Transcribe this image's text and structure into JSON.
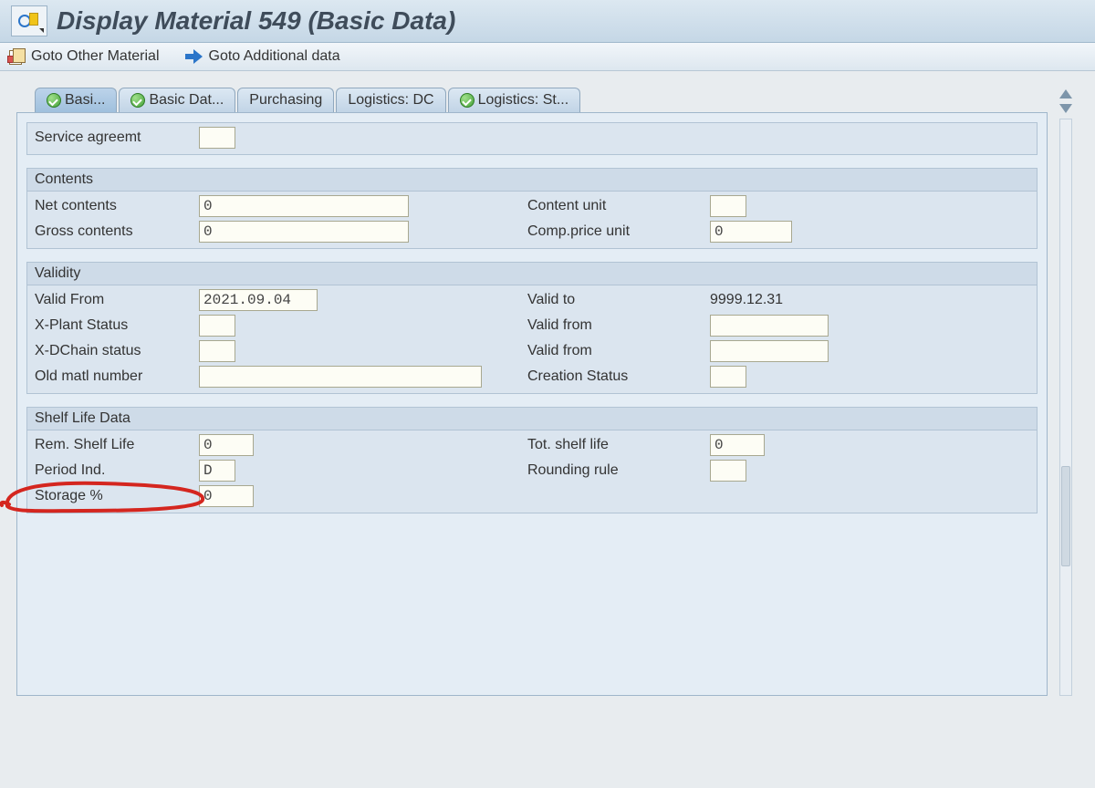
{
  "header": {
    "title": "Display Material 549 (Basic Data)"
  },
  "toolbar": {
    "goto_other": "Goto Other Material",
    "goto_add": "Goto Additional data"
  },
  "tabs": [
    {
      "label": "Basi...",
      "icon": true
    },
    {
      "label": "Basic Dat...",
      "icon": true
    },
    {
      "label": "Purchasing",
      "icon": false
    },
    {
      "label": "Logistics: DC",
      "icon": false
    },
    {
      "label": "Logistics: St...",
      "icon": true
    }
  ],
  "service": {
    "title": "Service agreemt",
    "value": ""
  },
  "contents": {
    "title": "Contents",
    "net_label": "Net contents",
    "net_value": "0",
    "gross_label": "Gross contents",
    "gross_value": "0",
    "cu_label": "Content unit",
    "cu_value": "",
    "cpu_label": "Comp.price unit",
    "cpu_value": "0"
  },
  "validity": {
    "title": "Validity",
    "from_label": "Valid From",
    "from_value": "2021.09.04",
    "xplant_label": "X-Plant Status",
    "xplant_value": "",
    "xdchain_label": "X-DChain status",
    "xdchain_value": "",
    "oldmat_label": "Old matl number",
    "oldmat_value": "",
    "to_label": "Valid to",
    "to_value": "9999.12.31",
    "vfrom1_label": "Valid from",
    "vfrom1_value": "",
    "vfrom2_label": "Valid from",
    "vfrom2_value": "",
    "cstat_label": "Creation Status",
    "cstat_value": ""
  },
  "shelf": {
    "title": "Shelf Life Data",
    "rem_label": "Rem. Shelf Life",
    "rem_value": "0",
    "period_label": "Period Ind.",
    "period_value": "D",
    "storage_label": "Storage %",
    "storage_value": "0",
    "tot_label": "Tot. shelf life",
    "tot_value": "0",
    "round_label": "Rounding rule",
    "round_value": ""
  }
}
